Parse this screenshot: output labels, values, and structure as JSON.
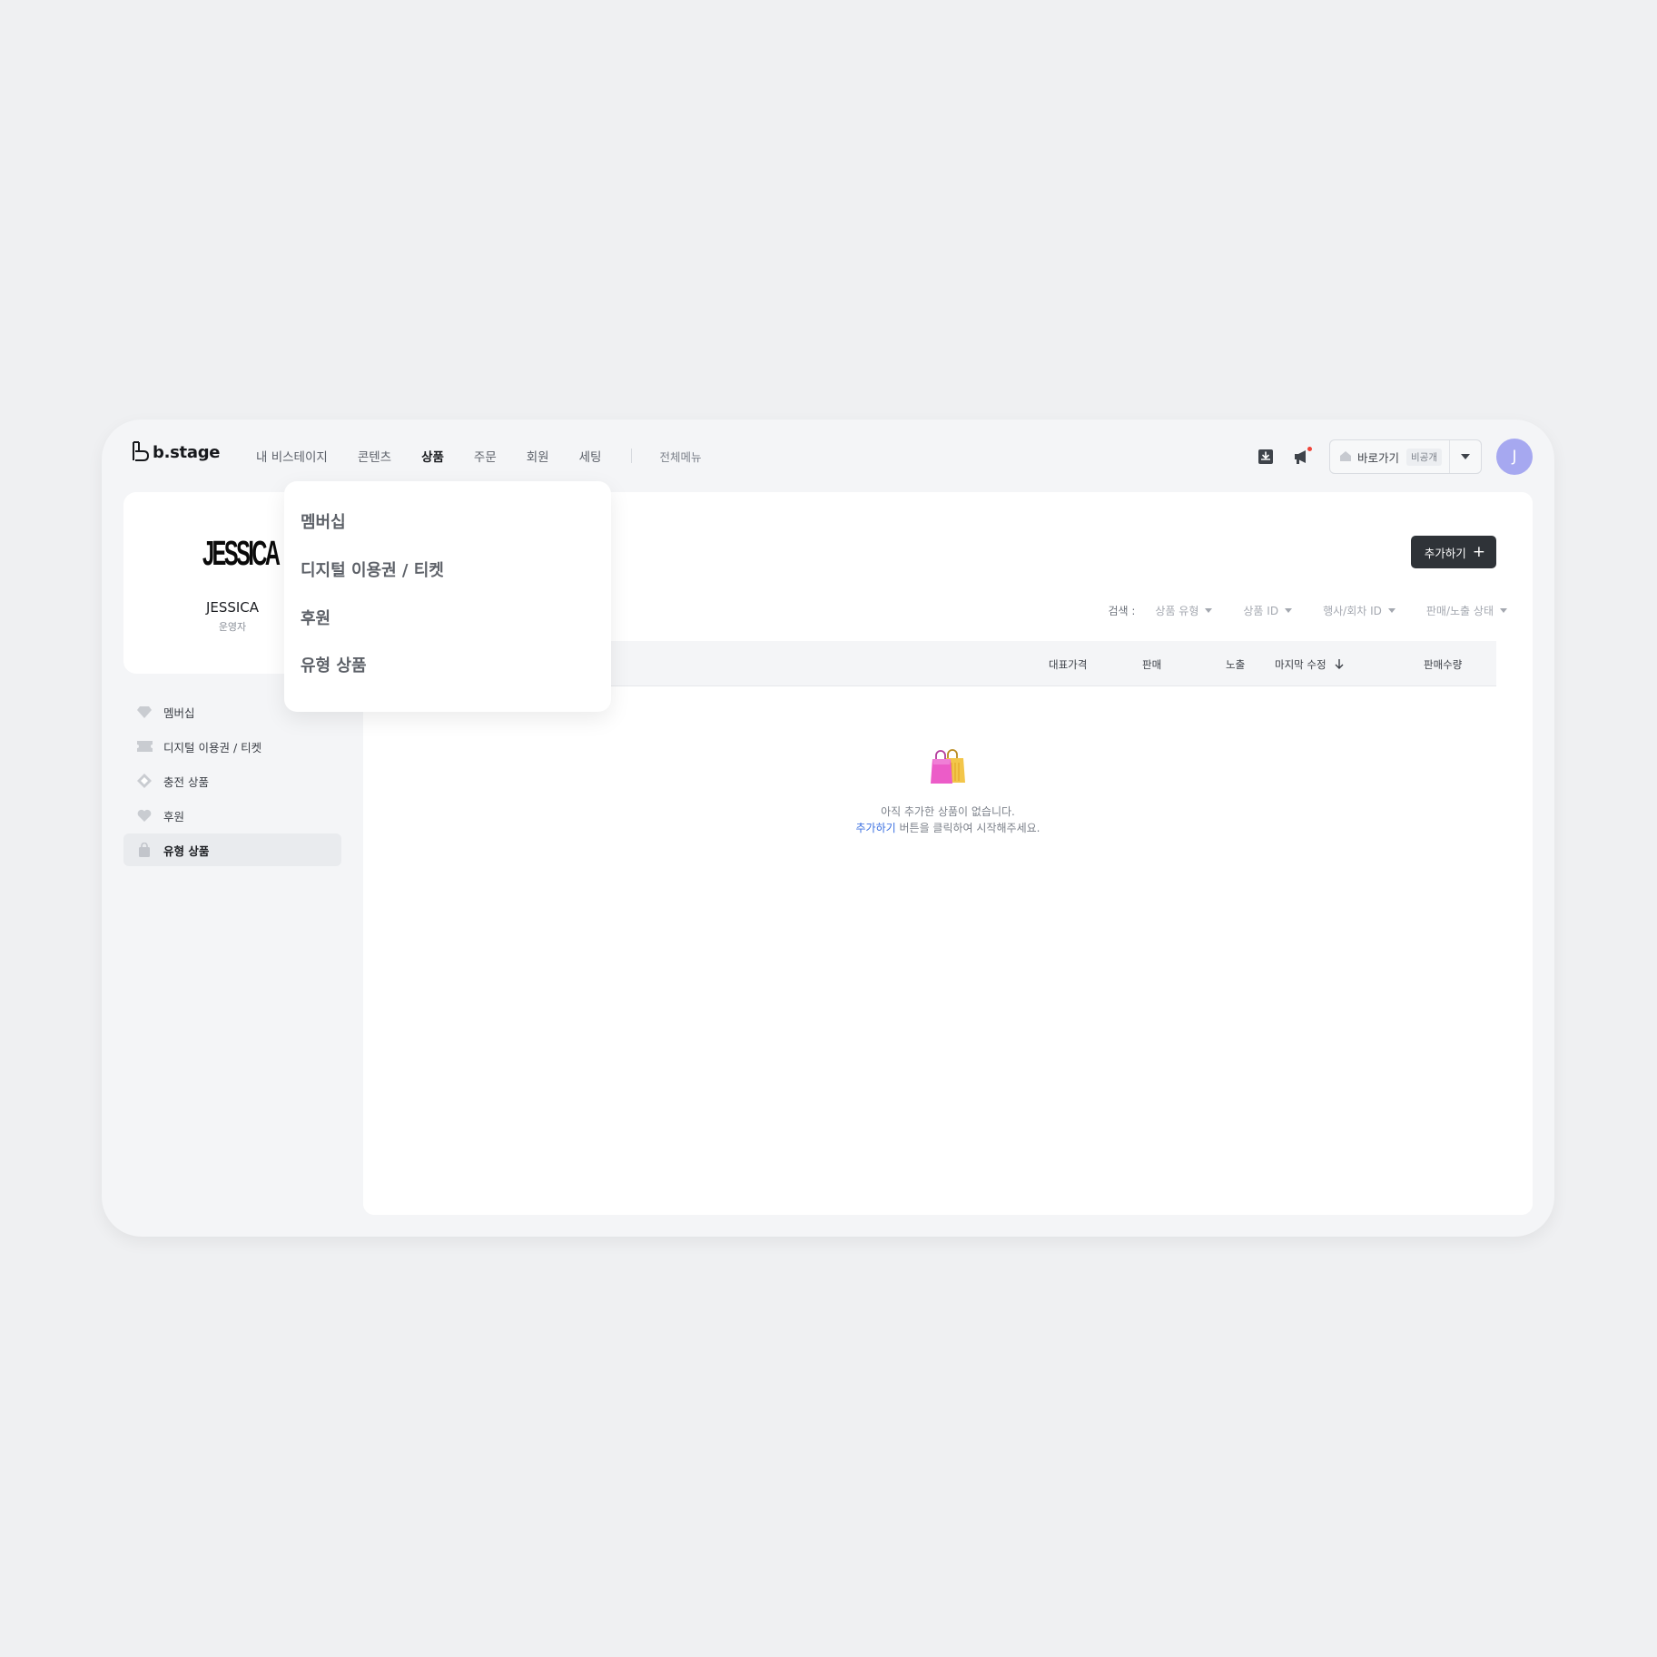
{
  "brand": {
    "name": "b.stage"
  },
  "nav": {
    "items": [
      {
        "label": "내 비스테이지",
        "active": false
      },
      {
        "label": "콘텐츠",
        "active": false
      },
      {
        "label": "상품",
        "active": true
      },
      {
        "label": "주문",
        "active": false
      },
      {
        "label": "회원",
        "active": false
      },
      {
        "label": "세팅",
        "active": false
      }
    ],
    "all_menu": "전체메뉴"
  },
  "header_tools": {
    "icons": [
      "download-icon",
      "megaphone-icon"
    ],
    "shortcut_label": "바로가기",
    "shortcut_badge": "비공개",
    "avatar_initial": "J"
  },
  "profile": {
    "logo_text": "JESSICA",
    "name": "JESSICA",
    "role": "운영자"
  },
  "sidebar": {
    "items": [
      {
        "label": "멤버십",
        "icon": "diamond-icon",
        "active": false
      },
      {
        "label": "디지털 이용권 / 티켓",
        "icon": "ticket-icon",
        "active": false
      },
      {
        "label": "충전 상품",
        "icon": "charge-icon",
        "active": false
      },
      {
        "label": "후원",
        "icon": "heart-icon",
        "active": false
      },
      {
        "label": "유형 상품",
        "icon": "bag-icon",
        "active": true
      }
    ]
  },
  "main": {
    "add_button": "추가하기",
    "filters": {
      "label": "검색 :",
      "items": [
        "상품 유형",
        "상품 ID",
        "행사/회차 ID",
        "판매/노출 상태"
      ]
    },
    "table_headers": [
      "대표가격",
      "판매",
      "노출",
      "마지막 수정",
      "판매수량"
    ],
    "empty": {
      "line1": "아직 추가한 상품이 없습니다.",
      "link": "추가하기",
      "line2_rest": " 버튼을 클릭하여 시작해주세요."
    }
  },
  "dropdown": {
    "items": [
      "멤버십",
      "디지털 이용권 / 티켓",
      "후원",
      "유형 상품"
    ]
  },
  "colors": {
    "page_bg": "#eff0f2",
    "accent_dark": "#2f3338",
    "avatar": "#a6a8f0",
    "link": "#3b6fe0",
    "notification": "#f0453a"
  }
}
